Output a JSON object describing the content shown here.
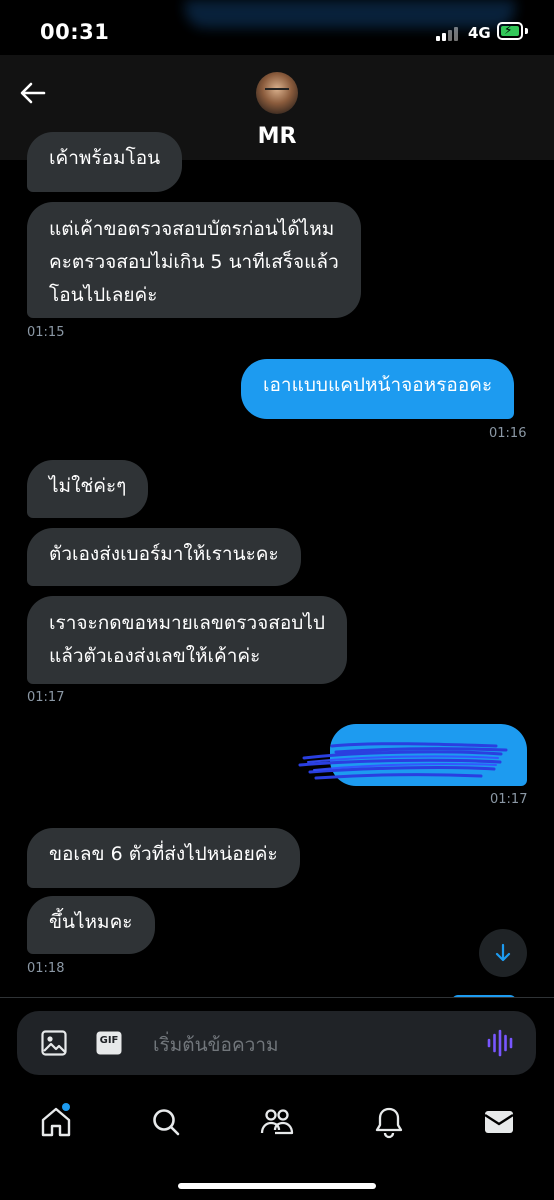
{
  "status": {
    "time": "00:31",
    "network": "4G"
  },
  "header": {
    "title": "MR"
  },
  "messages": {
    "m0": "เค้าพร้อมโอน",
    "m1": [
      "แต่เค้าขอตรวจสอบบัตรก่อนได้ไหม",
      "คะตรวจสอบไม่เกิน 5 นาทีเสร็จแล้ว",
      "โอนไปเลยค่ะ"
    ],
    "m1_time": "01:15",
    "m2": "เอาแบบแคปหน้าจอหรออคะ",
    "m2_time": "01:16",
    "m3": "ไม่ใช่ค่ะๆ",
    "m4": "ตัวเองส่งเบอร์มาให้เรานะคะ",
    "m5": [
      "เราจะกดขอหมายเลขตรวจสอบไป",
      "แล้วตัวเองส่งเลขให้เค้าค่ะ"
    ],
    "m5_time": "01:17",
    "m6_time": "01:17",
    "m7": "ขอเลข 6 ตัวที่ส่งไปหน่อยค่ะ",
    "m8": "ขึ้นไหมคะ",
    "m8_time": "01:18"
  },
  "composer": {
    "placeholder": "เริ่มต้นข้อความ",
    "gif_label": "GIF"
  },
  "icons": {
    "back": "arrow-left-icon",
    "image": "image-icon",
    "gif": "gif-icon",
    "voice": "voice-wave-icon",
    "scroll": "arrow-down-icon",
    "home": "home-icon",
    "search": "search-icon",
    "communities": "people-icon",
    "notifications": "bell-icon",
    "messages": "envelope-icon"
  },
  "colors": {
    "accent": "#1d9bf0",
    "bubble_received": "#2f3336",
    "background": "#000000",
    "voice": "#7856ff"
  }
}
